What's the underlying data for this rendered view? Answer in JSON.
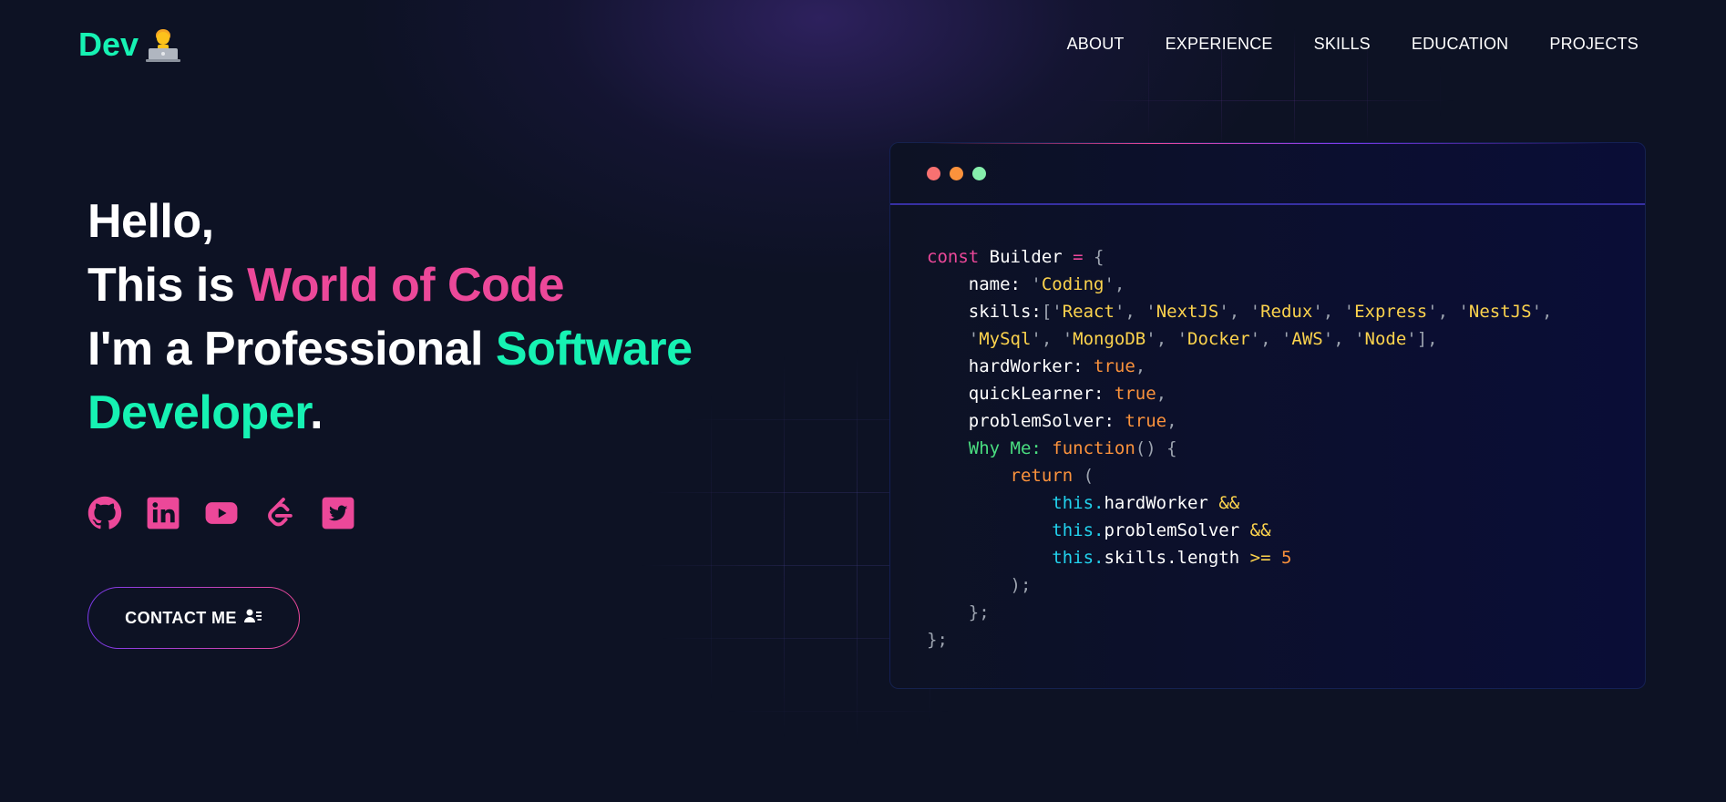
{
  "nav": {
    "logo_text": "Dev",
    "links": [
      "ABOUT",
      "EXPERIENCE",
      "SKILLS",
      "EDUCATION",
      "PROJECTS"
    ]
  },
  "hero": {
    "line1": "Hello,",
    "line2_prefix": "This is ",
    "line2_highlight": "World of Code",
    "line3_prefix": "I'm a Professional ",
    "line3_highlight": "Software",
    "line4_highlight": "Developer",
    "line4_suffix": "."
  },
  "socials": [
    "github-icon",
    "linkedin-icon",
    "youtube-icon",
    "leetcode-icon",
    "twitter-icon"
  ],
  "contact_button": {
    "label": "CONTACT ME"
  },
  "code_window": {
    "dots": [
      "#f87171",
      "#fb923c",
      "#86efac"
    ],
    "lines": [
      [
        [
          "k-pink",
          "const "
        ],
        [
          "k-white",
          "Builder "
        ],
        [
          "k-pink",
          "= "
        ],
        [
          "k-gray",
          "{"
        ]
      ],
      [
        [
          "k-white",
          "    name: "
        ],
        [
          "k-gray",
          "'"
        ],
        [
          "k-amber",
          "Coding"
        ],
        [
          "k-gray",
          "',"
        ]
      ],
      [
        [
          "k-white",
          "    skills:"
        ],
        [
          "k-gray",
          "['"
        ],
        [
          "k-amber",
          "React"
        ],
        [
          "k-gray",
          "', '"
        ],
        [
          "k-amber",
          "NextJS"
        ],
        [
          "k-gray",
          "', '"
        ],
        [
          "k-amber",
          "Redux"
        ],
        [
          "k-gray",
          "', '"
        ],
        [
          "k-amber",
          "Express"
        ],
        [
          "k-gray",
          "', '"
        ],
        [
          "k-amber",
          "NestJS"
        ],
        [
          "k-gray",
          "',"
        ]
      ],
      [
        [
          "k-gray",
          "    '"
        ],
        [
          "k-amber",
          "MySql"
        ],
        [
          "k-gray",
          "', '"
        ],
        [
          "k-amber",
          "MongoDB"
        ],
        [
          "k-gray",
          "', '"
        ],
        [
          "k-amber",
          "Docker"
        ],
        [
          "k-gray",
          "', '"
        ],
        [
          "k-amber",
          "AWS"
        ],
        [
          "k-gray",
          "', '"
        ],
        [
          "k-amber",
          "Node"
        ],
        [
          "k-gray",
          "'],"
        ]
      ],
      [
        [
          "k-white",
          "    hardWorker: "
        ],
        [
          "k-orange",
          "true"
        ],
        [
          "k-gray",
          ","
        ]
      ],
      [
        [
          "k-white",
          "    quickLearner: "
        ],
        [
          "k-orange",
          "true"
        ],
        [
          "k-gray",
          ","
        ]
      ],
      [
        [
          "k-white",
          "    problemSolver: "
        ],
        [
          "k-orange",
          "true"
        ],
        [
          "k-gray",
          ","
        ]
      ],
      [
        [
          "k-green",
          "    Why Me: "
        ],
        [
          "k-orange",
          "function"
        ],
        [
          "k-gray",
          "() {"
        ]
      ],
      [
        [
          "k-orange",
          "        return "
        ],
        [
          "k-gray",
          "("
        ]
      ],
      [
        [
          "k-cyan",
          "            this."
        ],
        [
          "k-white",
          "hardWorker "
        ],
        [
          "k-amber",
          "&&"
        ]
      ],
      [
        [
          "k-cyan",
          "            this."
        ],
        [
          "k-white",
          "problemSolver "
        ],
        [
          "k-amber",
          "&&"
        ]
      ],
      [
        [
          "k-cyan",
          "            this."
        ],
        [
          "k-white",
          "skills.length "
        ],
        [
          "k-amber",
          ">= "
        ],
        [
          "k-orange",
          "5"
        ]
      ],
      [
        [
          "k-gray",
          "        );"
        ]
      ],
      [
        [
          "k-gray",
          "    };"
        ]
      ],
      [
        [
          "k-gray",
          "};"
        ]
      ]
    ]
  }
}
